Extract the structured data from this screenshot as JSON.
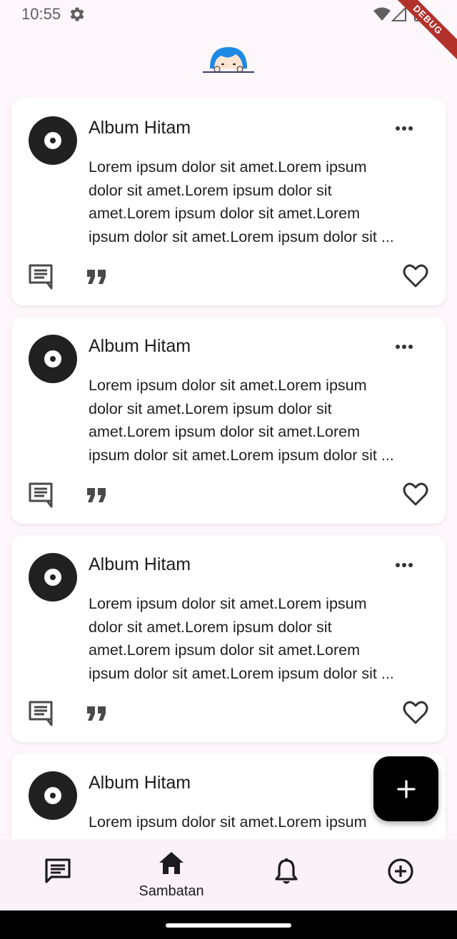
{
  "status_bar": {
    "time": "10:55"
  },
  "debug_banner": "DEBUG",
  "posts": [
    {
      "title": "Album Hitam",
      "lines": [
        "Lorem ipsum dolor sit amet.Lorem ipsum",
        "dolor sit amet.Lorem ipsum dolor sit",
        "amet.Lorem ipsum dolor sit amet.Lorem",
        "ipsum dolor sit amet.Lorem ipsum dolor sit ..."
      ]
    },
    {
      "title": "Album Hitam",
      "lines": [
        "Lorem ipsum dolor sit amet.Lorem ipsum",
        "dolor sit amet.Lorem ipsum dolor sit",
        "amet.Lorem ipsum dolor sit amet.Lorem",
        "ipsum dolor sit amet.Lorem ipsum dolor sit ..."
      ]
    },
    {
      "title": "Album Hitam",
      "lines": [
        "Lorem ipsum dolor sit amet.Lorem ipsum",
        "dolor sit amet.Lorem ipsum dolor sit",
        "amet.Lorem ipsum dolor sit amet.Lorem",
        "ipsum dolor sit amet.Lorem ipsum dolor sit ..."
      ]
    },
    {
      "title": "Album Hitam",
      "lines": [
        "Lorem ipsum dolor sit amet.Lorem ipsum"
      ]
    }
  ],
  "fab": {
    "icon": "plus-icon"
  },
  "bottom_nav": {
    "items": [
      {
        "icon": "chat-icon",
        "label": ""
      },
      {
        "icon": "home-icon",
        "label": "Sambatan",
        "selected": true
      },
      {
        "icon": "bell-icon",
        "label": ""
      },
      {
        "icon": "add-circle-icon",
        "label": ""
      }
    ]
  },
  "colors": {
    "background": "#fdf7fc",
    "card": "#ffffff",
    "fab": "#000000",
    "nav": "#fbf1f9",
    "debug": "#b2322b"
  }
}
